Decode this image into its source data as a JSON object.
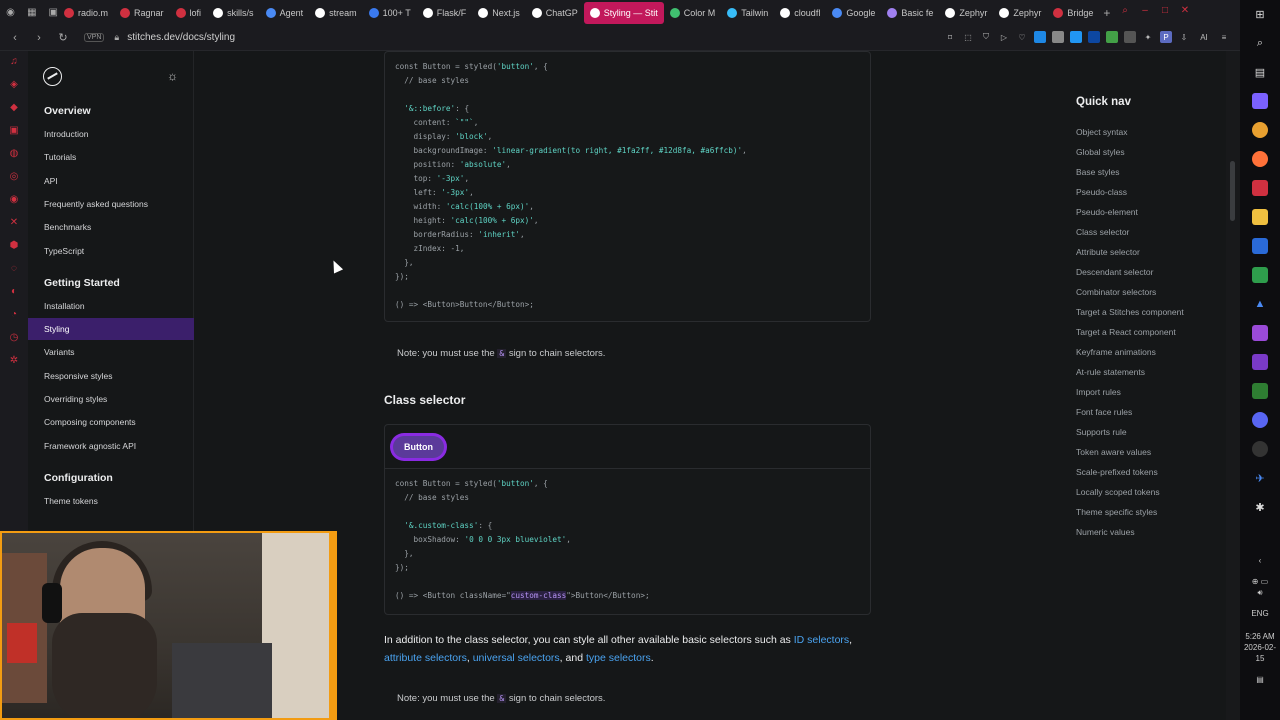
{
  "browser": {
    "tabs": [
      {
        "label": "radio.m",
        "color": "#d03040"
      },
      {
        "label": "Ragnar",
        "color": "#d03040"
      },
      {
        "label": "lofi",
        "color": "#d03040"
      },
      {
        "label": "skills/s",
        "color": "#ffffff"
      },
      {
        "label": "Agent",
        "color": "#4a8af4"
      },
      {
        "label": "stream",
        "color": "#ffffff"
      },
      {
        "label": "100+ T",
        "color": "#3a7af0"
      },
      {
        "label": "Flask/F",
        "color": "#ffffff"
      },
      {
        "label": "Next.js",
        "color": "#ffffff"
      },
      {
        "label": "ChatGP",
        "color": "#ffffff"
      },
      {
        "label": "Styling — Stit",
        "color": "#ffffff",
        "active": true
      },
      {
        "label": "Color M",
        "color": "#40c070"
      },
      {
        "label": "Tailwin",
        "color": "#38bdf8"
      },
      {
        "label": "cloudfl",
        "color": "#ffffff"
      },
      {
        "label": "Google",
        "color": "#4a8af4"
      },
      {
        "label": "Basic fe",
        "color": "#a080f0"
      },
      {
        "label": "Zephyr",
        "color": "#ffffff"
      },
      {
        "label": "Zephyr",
        "color": "#ffffff"
      },
      {
        "label": "Bridge",
        "color": "#d03040"
      }
    ],
    "vpn_label": "VPN",
    "url": "stitches.dev/docs/styling"
  },
  "taskbar": {
    "lang": "ENG",
    "time": "5:26 AM",
    "date": "2026-02-15"
  },
  "sidebar": {
    "groups": [
      {
        "title": "Overview",
        "items": [
          "Introduction",
          "Tutorials",
          "API",
          "Frequently asked questions",
          "Benchmarks",
          "TypeScript"
        ]
      },
      {
        "title": "Getting Started",
        "items": [
          "Installation",
          "Styling",
          "Variants",
          "Responsive styles",
          "Overriding styles",
          "Composing components",
          "Framework agnostic API"
        ]
      },
      {
        "title": "Configuration",
        "items": [
          "Theme tokens"
        ]
      }
    ],
    "active_item": "Styling"
  },
  "content": {
    "code1": [
      "const Button = styled('button', {",
      "  // base styles",
      "",
      "  '&::before': {",
      "    content: `\"\"`,",
      "    display: 'block',",
      "    backgroundImage: 'linear-gradient(to right, #1fa2ff, #12d8fa, #a6ffcb)',",
      "    position: 'absolute',",
      "    top: '-3px',",
      "    left: '-3px',",
      "    width: 'calc(100% + 6px)',",
      "    height: 'calc(100% + 6px)',",
      "    borderRadius: 'inherit',",
      "    zIndex: -1,",
      "  },",
      "});",
      "",
      "() => <Button>Button</Button>;"
    ],
    "note1_pre": "Note: you must use the",
    "note_amp": "&",
    "note1_post": "sign to chain selectors.",
    "section_title": "Class selector",
    "demo_button": "Button",
    "code2": [
      "const Button = styled('button', {",
      "  // base styles",
      "",
      "  '&.custom-class': {",
      "    boxShadow: '0 0 0 3px blueviolet',",
      "  },",
      "});",
      "",
      "() => <Button className=\"custom-class\">Button</Button>;"
    ],
    "para_pre": "In addition to the class selector, you can style all other available basic selectors such as",
    "link_id": "ID selectors",
    "link_attr": "attribute selectors",
    "link_universal": "universal selectors",
    "para_and": "and",
    "link_type": "type selectors",
    "note2_pre": "Note: you must use the",
    "note2_post": "sign to chain selectors."
  },
  "quicknav": {
    "title": "Quick nav",
    "items": [
      "Object syntax",
      "Global styles",
      "Base styles",
      "Pseudo-class",
      "Pseudo-element",
      "Class selector",
      "Attribute selector",
      "Descendant selector",
      "Combinator selectors",
      "Target a Stitches component",
      "Target a React component",
      "Keyframe animations",
      "At-rule statements",
      "Import rules",
      "Font face rules",
      "Supports rule",
      "Token aware values",
      "Scale-prefixed tokens",
      "Locally scoped tokens",
      "Theme specific styles",
      "Numeric values"
    ]
  }
}
